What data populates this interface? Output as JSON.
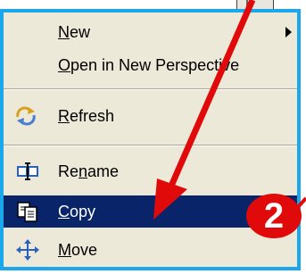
{
  "context_menu": {
    "items": [
      {
        "label_pre": "",
        "mnemonic": "N",
        "label_post": "ew",
        "icon": "",
        "has_submenu": true
      },
      {
        "label_pre": "",
        "mnemonic": "O",
        "label_post": "pen in New Perspective",
        "icon": ""
      },
      {
        "label_pre": "",
        "mnemonic": "R",
        "label_post": "efresh",
        "icon": "refresh-icon"
      },
      {
        "label_pre": "Re",
        "mnemonic": "n",
        "label_post": "ame",
        "icon": "rename-icon"
      },
      {
        "label_pre": "",
        "mnemonic": "C",
        "label_post": "opy",
        "icon": "copy-icon",
        "selected": true
      },
      {
        "label_pre": "",
        "mnemonic": "M",
        "label_post": "ove",
        "icon": "move-icon"
      }
    ]
  },
  "annotation": {
    "step_number": "2",
    "arrow_color": "#e10a0a",
    "frame_color": "#1aa7ec"
  },
  "colors": {
    "menu_background": "#ece9d8",
    "selection": "#0a246a"
  }
}
